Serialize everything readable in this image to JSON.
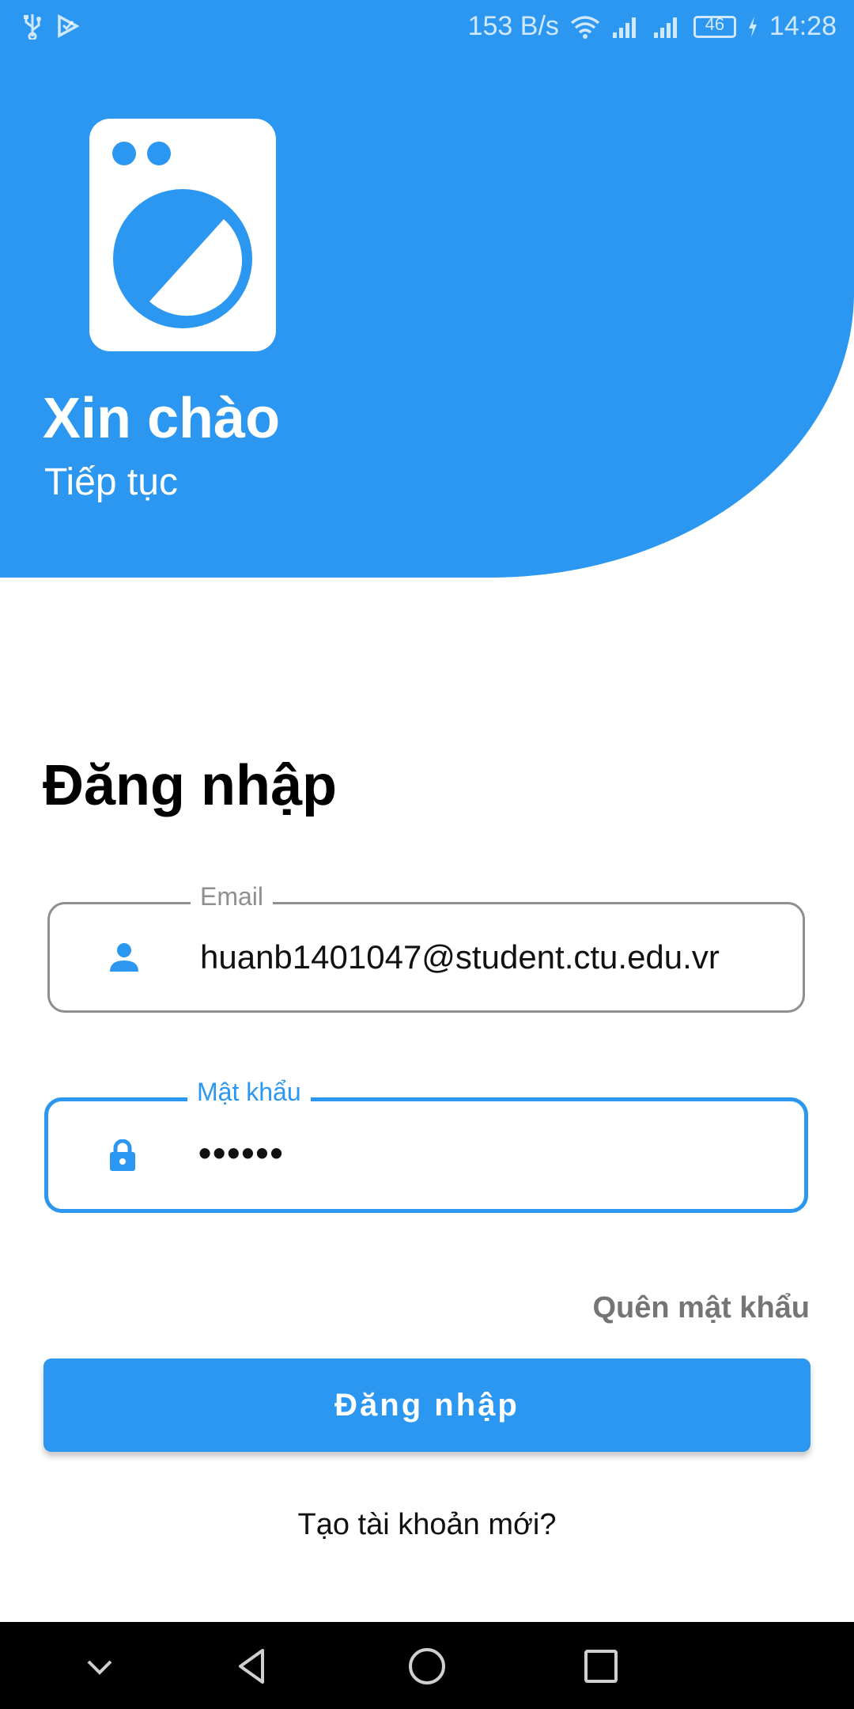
{
  "status_bar": {
    "network_speed": "153 B/s",
    "battery_level": "46",
    "time": "14:28",
    "icons": [
      "usb-icon",
      "play-store-notification-icon",
      "wifi-icon",
      "signal-icon",
      "signal-icon",
      "battery-icon",
      "charging-icon"
    ]
  },
  "header": {
    "logo": "washing-machine-icon",
    "title": "Xin chào",
    "subtitle": "Tiếp tục"
  },
  "login": {
    "heading": "Đăng nhập",
    "email": {
      "label": "Email",
      "value": "huanb1401047@student.ctu.edu.vr",
      "icon": "person-icon"
    },
    "password": {
      "label": "Mật khẩu",
      "value": "••••••",
      "icon": "lock-icon"
    },
    "forgot_password": "Quên mật khẩu",
    "submit_label": "Đăng nhập",
    "create_account": "Tạo tài khoản mới?"
  },
  "nav_bar": {
    "buttons": [
      "chevron-down-icon",
      "back-icon",
      "home-icon",
      "recents-icon"
    ]
  },
  "colors": {
    "primary": "#2b97f0",
    "text_dark": "#111111",
    "text_gray": "#757575",
    "outline_gray": "#8f8f8f",
    "nav_bg": "#000000"
  }
}
